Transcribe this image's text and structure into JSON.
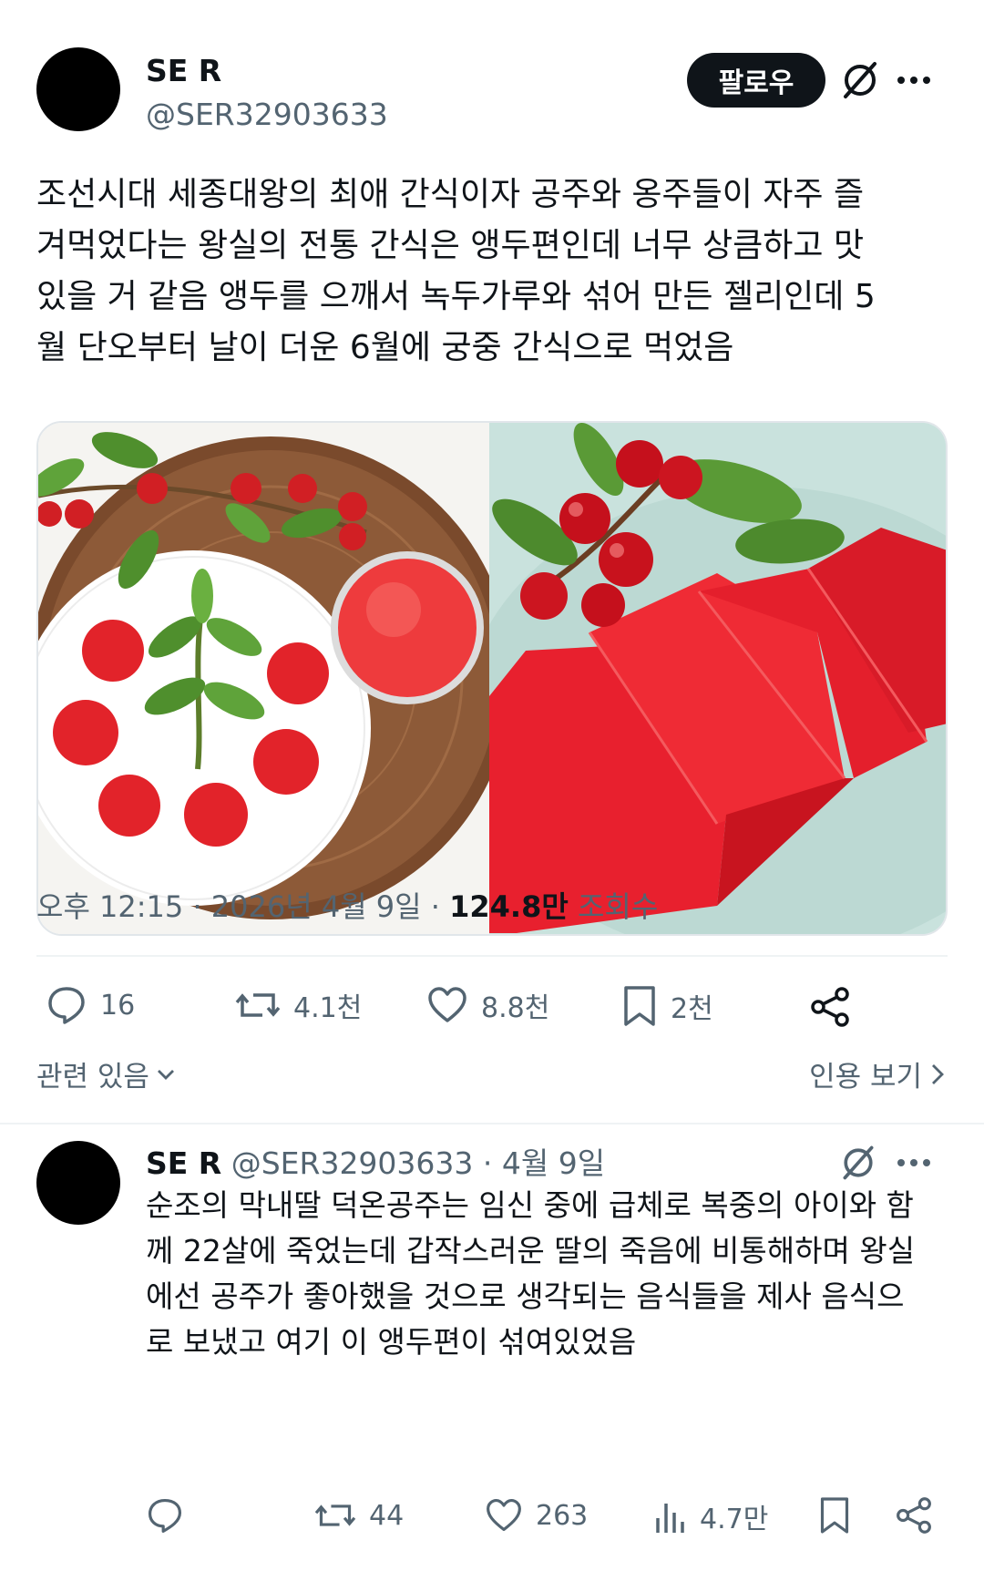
{
  "post": {
    "author_name": "SE R",
    "author_handle": "@SER32903633",
    "follow_label": "팔로우",
    "text_lines": [
      "조선시대 세종대왕의 최애 간식이자 공주와 옹주들이 자주 즐",
      "겨먹었다는 왕실의 전통 간식은 앵두편인데 너무 상큼하고 맛",
      "있을 거 같음 앵두를 으깨서 녹두가루와 섞어 만든 젤리인데 5",
      "월 단오부터 날이 더운 6월에 궁중 간식으로 먹었음"
    ],
    "timestamp": "오후 12:15 · 2026년 4월 9일 · ",
    "views_count": "124.8만",
    "views_label": " 조회수",
    "stats": {
      "replies": "16",
      "reposts": "4.1천",
      "likes": "8.8천",
      "bookmarks": "2천"
    },
    "related_label": "관련 있음",
    "quotes_label": "인용 보기"
  },
  "reply": {
    "author_name": "SE R",
    "author_handle": "@SER32903633",
    "date": "· 4월 9일",
    "text_lines": [
      "순조의 막내딸 덕온공주는 임신 중에 급체로 복중의 아이와 함",
      "께 22살에 죽었는데 갑작스러운 딸의 죽음에 비통해하며 왕실",
      "에선 공주가 좋아했을 것으로 생각되는 음식들을 제사 음식으",
      "로 보냈고 여기 이 앵두편이 섞여있었음"
    ],
    "stats": {
      "reposts": "44",
      "likes": "263",
      "views": "4.7만"
    }
  },
  "colors": {
    "text_primary": "#0f1419",
    "text_secondary": "#536471",
    "divider": "#eff3f4",
    "follow_bg": "#0f1419"
  },
  "icons": [
    "grok-icon",
    "more-icon",
    "reply-icon",
    "repost-icon",
    "like-icon",
    "bookmark-icon",
    "share-icon",
    "chevron-down-icon",
    "chevron-right-icon",
    "views-icon"
  ]
}
